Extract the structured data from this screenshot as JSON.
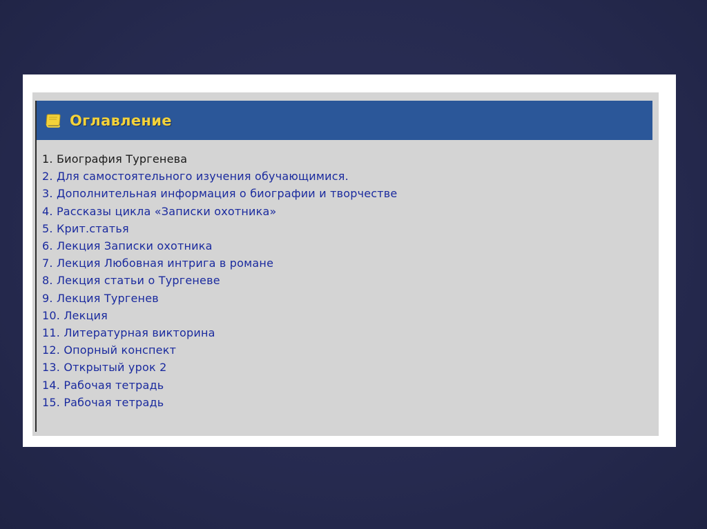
{
  "toc": {
    "title": "Оглавление",
    "icon": "book-icon",
    "colors": {
      "header_bg": "#2b5799",
      "title": "#f3d23a",
      "link": "#1a2a9e",
      "current": "#1a1a1a",
      "panel_bg": "#d4d4d4"
    },
    "items": [
      {
        "label": "1. Биография Тургенева"
      },
      {
        "label": "2. Для самостоятельного изучения обучающимися."
      },
      {
        "label": "3. Дополнительная информация о биографии и творчестве"
      },
      {
        "label": "4. Рассказы цикла «Записки охотника»"
      },
      {
        "label": "5. Крит.статья"
      },
      {
        "label": "6. Лекция Записки охотника"
      },
      {
        "label": "7. Лекция Любовная интрига в романе"
      },
      {
        "label": "8. Лекция статьи о Тургеневе"
      },
      {
        "label": "9. Лекция Тургенев"
      },
      {
        "label": "10. Лекция"
      },
      {
        "label": "11. Литературная викторина"
      },
      {
        "label": "12. Опорный конспект"
      },
      {
        "label": "13. Открытый урок 2"
      },
      {
        "label": "14. Рабочая тетрадь"
      },
      {
        "label": "15. Рабочая тетрадь"
      }
    ]
  }
}
